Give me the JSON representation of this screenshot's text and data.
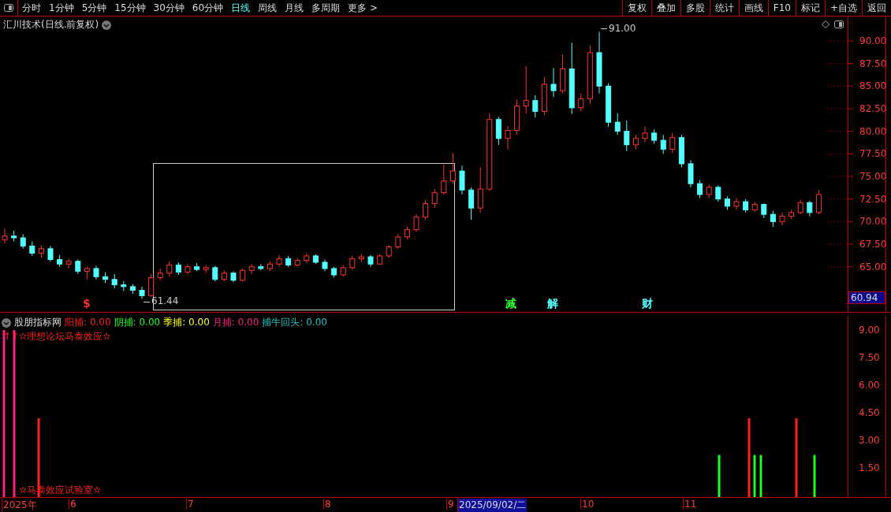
{
  "toolbar": {
    "periods": [
      {
        "label": "分时",
        "selected": false
      },
      {
        "label": "1分钟",
        "selected": false
      },
      {
        "label": "5分钟",
        "selected": false
      },
      {
        "label": "15分钟",
        "selected": false
      },
      {
        "label": "30分钟",
        "selected": false
      },
      {
        "label": "60分钟",
        "selected": false
      },
      {
        "label": "日线",
        "selected": true
      },
      {
        "label": "周线",
        "selected": false
      },
      {
        "label": "月线",
        "selected": false
      },
      {
        "label": "多周期",
        "selected": false
      },
      {
        "label": "更多 >",
        "selected": false
      }
    ],
    "buttons": [
      "复权",
      "叠加",
      "多股",
      "统计",
      "画线",
      "F10",
      "标记",
      "+自选",
      "返回"
    ]
  },
  "main_chart": {
    "title": "汇川技术(日线.前复权)",
    "high_label": "91.00",
    "low_label": "61.44",
    "markers": [
      {
        "text": "$",
        "color": "#ff3030"
      },
      {
        "text": "减",
        "color": "#30ff30"
      },
      {
        "text": "解",
        "color": "#54ffff"
      },
      {
        "text": "财",
        "color": "#54ffff"
      }
    ],
    "current_price": "60.94",
    "chart_data": {
      "type": "candlestick",
      "ylim": [
        60,
        92.7
      ],
      "yticks": [
        {
          "value": 90,
          "label": "90.00"
        },
        {
          "value": 87.5,
          "label": "87.50"
        },
        {
          "value": 85,
          "label": "85.00"
        },
        {
          "value": 82.5,
          "label": "82.50"
        },
        {
          "value": 80,
          "label": "80.00"
        },
        {
          "value": 77.5,
          "label": "77.50"
        },
        {
          "value": 75,
          "label": "75.00"
        },
        {
          "value": 72.5,
          "label": "72.50"
        },
        {
          "value": 70,
          "label": "70.00"
        },
        {
          "value": 67.5,
          "label": "67.50"
        },
        {
          "value": 65,
          "label": "65.00"
        }
      ],
      "ohlc": [
        [
          68.0,
          69.2,
          67.6,
          68.4
        ],
        [
          68.4,
          69.0,
          67.8,
          68.2
        ],
        [
          68.2,
          68.6,
          67.0,
          67.3
        ],
        [
          67.3,
          67.8,
          66.2,
          66.5
        ],
        [
          66.5,
          67.4,
          66.0,
          67.0
        ],
        [
          67.0,
          67.3,
          65.6,
          65.8
        ],
        [
          65.8,
          66.3,
          65.0,
          65.3
        ],
        [
          65.3,
          65.9,
          64.8,
          65.6
        ],
        [
          65.6,
          65.8,
          64.2,
          64.5
        ],
        [
          64.5,
          65.0,
          63.6,
          64.8
        ],
        [
          64.8,
          65.1,
          63.6,
          63.9
        ],
        [
          63.9,
          64.4,
          63.2,
          63.6
        ],
        [
          63.6,
          64.2,
          62.6,
          63.0
        ],
        [
          63.0,
          63.4,
          62.3,
          62.8
        ],
        [
          62.8,
          63.1,
          62.0,
          62.4
        ],
        [
          62.4,
          62.8,
          61.44,
          61.8
        ],
        [
          61.8,
          64.2,
          61.7,
          63.8
        ],
        [
          63.8,
          64.8,
          63.5,
          64.3
        ],
        [
          64.3,
          65.6,
          63.9,
          65.2
        ],
        [
          65.2,
          65.5,
          64.1,
          64.4
        ],
        [
          64.4,
          65.3,
          64.2,
          65.0
        ],
        [
          65.0,
          65.4,
          64.5,
          64.7
        ],
        [
          64.7,
          65.2,
          64.3,
          64.9
        ],
        [
          64.9,
          65.1,
          63.4,
          63.6
        ],
        [
          63.6,
          64.6,
          63.4,
          64.3
        ],
        [
          64.3,
          64.5,
          63.3,
          63.5
        ],
        [
          63.5,
          64.8,
          63.4,
          64.6
        ],
        [
          64.6,
          65.3,
          64.2,
          65.0
        ],
        [
          65.0,
          65.3,
          64.6,
          64.8
        ],
        [
          64.8,
          65.6,
          64.5,
          65.3
        ],
        [
          65.3,
          66.3,
          65.0,
          65.9
        ],
        [
          65.9,
          66.2,
          65.0,
          65.2
        ],
        [
          65.2,
          66.0,
          65.0,
          65.7
        ],
        [
          65.7,
          66.5,
          65.4,
          66.2
        ],
        [
          66.2,
          66.4,
          65.3,
          65.5
        ],
        [
          65.5,
          65.8,
          64.5,
          64.8
        ],
        [
          64.8,
          65.0,
          63.8,
          64.1
        ],
        [
          64.1,
          65.2,
          63.9,
          64.9
        ],
        [
          64.9,
          66.2,
          64.7,
          65.9
        ],
        [
          65.9,
          66.4,
          65.5,
          66.1
        ],
        [
          66.1,
          66.3,
          65.0,
          65.3
        ],
        [
          65.3,
          66.4,
          65.2,
          66.2
        ],
        [
          66.2,
          67.4,
          66.0,
          67.2
        ],
        [
          67.2,
          68.6,
          67.0,
          68.3
        ],
        [
          68.3,
          69.5,
          68.0,
          69.1
        ],
        [
          69.1,
          70.8,
          68.9,
          70.5
        ],
        [
          70.5,
          72.4,
          70.2,
          72.0
        ],
        [
          72.0,
          73.6,
          71.5,
          73.2
        ],
        [
          73.2,
          76.3,
          73.0,
          74.5
        ],
        [
          74.5,
          77.6,
          74.2,
          75.6
        ],
        [
          75.6,
          76.2,
          73.0,
          73.5
        ],
        [
          73.5,
          73.8,
          70.2,
          71.5
        ],
        [
          71.5,
          76.0,
          71.0,
          73.6
        ],
        [
          73.6,
          82.0,
          73.4,
          81.3
        ],
        [
          81.3,
          81.6,
          78.5,
          79.2
        ],
        [
          79.2,
          80.6,
          78.0,
          80.1
        ],
        [
          80.1,
          83.5,
          79.6,
          82.8
        ],
        [
          82.8,
          87.2,
          82.0,
          83.4
        ],
        [
          83.4,
          84.0,
          81.5,
          82.2
        ],
        [
          82.2,
          86.0,
          81.8,
          85.2
        ],
        [
          85.2,
          87.0,
          83.8,
          84.5
        ],
        [
          84.5,
          88.5,
          84.2,
          86.9
        ],
        [
          86.9,
          89.8,
          81.9,
          82.6
        ],
        [
          82.6,
          84.2,
          82.2,
          83.6
        ],
        [
          83.6,
          89.5,
          83.0,
          88.7
        ],
        [
          88.7,
          91.0,
          84.2,
          85.0
        ],
        [
          85.0,
          85.3,
          80.5,
          81.0
        ],
        [
          81.0,
          82.0,
          79.6,
          80.0
        ],
        [
          80.0,
          81.2,
          77.8,
          78.5
        ],
        [
          78.5,
          79.6,
          78.0,
          79.2
        ],
        [
          79.2,
          80.5,
          78.8,
          79.8
        ],
        [
          79.8,
          80.2,
          78.6,
          79.0
        ],
        [
          79.0,
          79.6,
          77.5,
          78.0
        ],
        [
          78.0,
          79.8,
          77.6,
          79.3
        ],
        [
          79.3,
          79.6,
          76.0,
          76.4
        ],
        [
          76.4,
          76.8,
          73.8,
          74.2
        ],
        [
          74.2,
          74.6,
          72.6,
          73.0
        ],
        [
          73.0,
          74.1,
          72.6,
          73.8
        ],
        [
          73.8,
          74.0,
          72.2,
          72.5
        ],
        [
          72.5,
          72.8,
          71.3,
          71.7
        ],
        [
          71.7,
          72.6,
          71.3,
          72.2
        ],
        [
          72.2,
          72.5,
          71.0,
          71.3
        ],
        [
          71.3,
          72.2,
          71.1,
          71.9
        ],
        [
          71.9,
          72.0,
          70.4,
          70.8
        ],
        [
          70.8,
          71.2,
          69.4,
          70.0
        ],
        [
          70.0,
          71.0,
          69.6,
          70.6
        ],
        [
          70.6,
          71.3,
          70.3,
          71.0
        ],
        [
          71.0,
          72.4,
          70.8,
          72.1
        ],
        [
          72.1,
          72.3,
          70.6,
          71.0
        ],
        [
          71.0,
          73.5,
          70.8,
          73.0
        ]
      ]
    }
  },
  "indicator": {
    "name": "股朋指标网",
    "values": [
      {
        "label": "阳捕:",
        "value": "0.00",
        "color": "#ff2020"
      },
      {
        "label": "阴捕:",
        "value": "0.00",
        "color": "#20ff20"
      },
      {
        "label": "季捕:",
        "value": "0.00",
        "color": "#ffff20"
      },
      {
        "label": "月捕:",
        "value": "0.00",
        "color": "#ff2080"
      },
      {
        "label": "捕牛回头:",
        "value": "0.00",
        "color": "#20c0c0"
      }
    ],
    "headline": "↑↑✫理想论坛马泰效应✫",
    "footer": "✫马泰效应试验室✫",
    "yticks": [
      "9.00",
      "7.50",
      "6.00",
      "4.50",
      "3.00",
      "1.50"
    ]
  },
  "date_axis": [
    {
      "label": "2025年",
      "selected": false
    },
    {
      "label": "6",
      "selected": false
    },
    {
      "label": "7",
      "selected": false
    },
    {
      "label": "8",
      "selected": false
    },
    {
      "label": "9",
      "selected": false
    },
    {
      "label": "2025/09/02/二",
      "selected": true
    },
    {
      "label": "10",
      "selected": false
    },
    {
      "label": "11",
      "selected": false
    }
  ]
}
